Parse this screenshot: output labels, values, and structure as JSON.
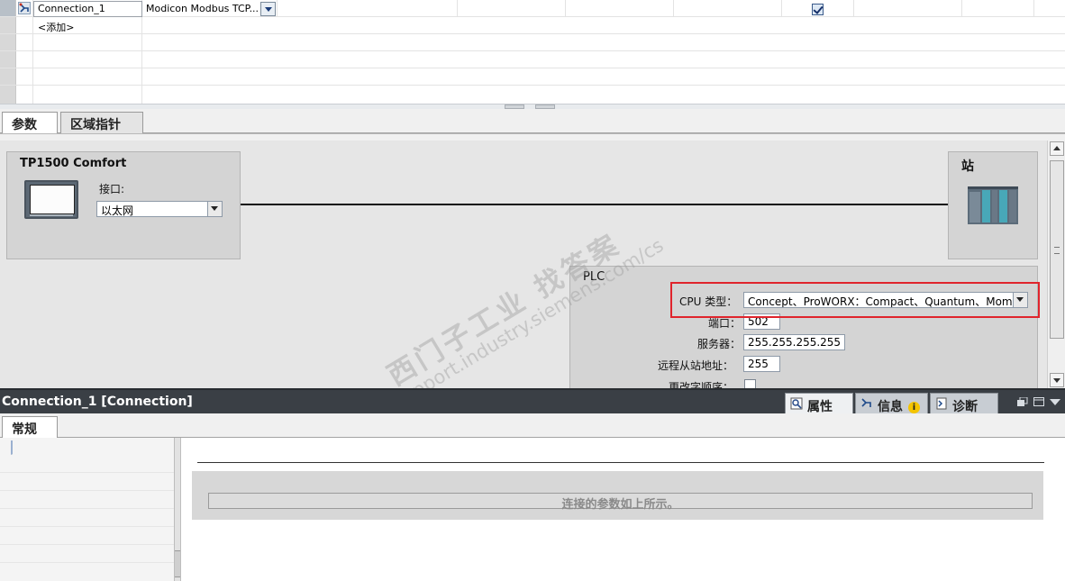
{
  "grid": {
    "rows": [
      {
        "name": "Connection_1",
        "driver": "Modicon Modbus TCP...",
        "enabled": true
      },
      {
        "name": "<添加>"
      }
    ]
  },
  "editor_tabs": [
    {
      "label": "参数",
      "active": true
    },
    {
      "label": "区域指针",
      "active": false
    }
  ],
  "hmi_device": {
    "title": "TP1500 Comfort",
    "interface_label": "接口:",
    "interface_value": "以太网"
  },
  "station": {
    "title": "站"
  },
  "plc": {
    "title": "PLC",
    "cpu_type_label": "CPU 类型：",
    "cpu_type_value": "Concept、ProWORX：Compact、Quantum、Momentum",
    "port_label": "端口：",
    "port_value": "502",
    "server_label": "服务器：",
    "server_value": "255.255.255.255",
    "remote_slave_label": "远程从站地址：",
    "remote_slave_value": "255",
    "byte_order_label": "更改字顺序："
  },
  "watermark": {
    "line1": "西门子工业  找答案",
    "line2": "support.industry.siemens.com/cs"
  },
  "inspector": {
    "title": "Connection_1 [Connection]",
    "tabs": [
      {
        "label": "属性",
        "icon": "properties-icon",
        "active": true
      },
      {
        "label": "信息",
        "icon": "info-icon",
        "active": false,
        "badge": "i"
      },
      {
        "label": "诊断",
        "icon": "diagnostics-icon",
        "active": false
      }
    ],
    "sub_tabs": [
      {
        "label": "常规",
        "active": true
      }
    ],
    "message": "连接的参数如上所示。"
  },
  "colors": {
    "highlight_border": "#e0242c",
    "inspector_header_bg": "#3a3f45"
  }
}
